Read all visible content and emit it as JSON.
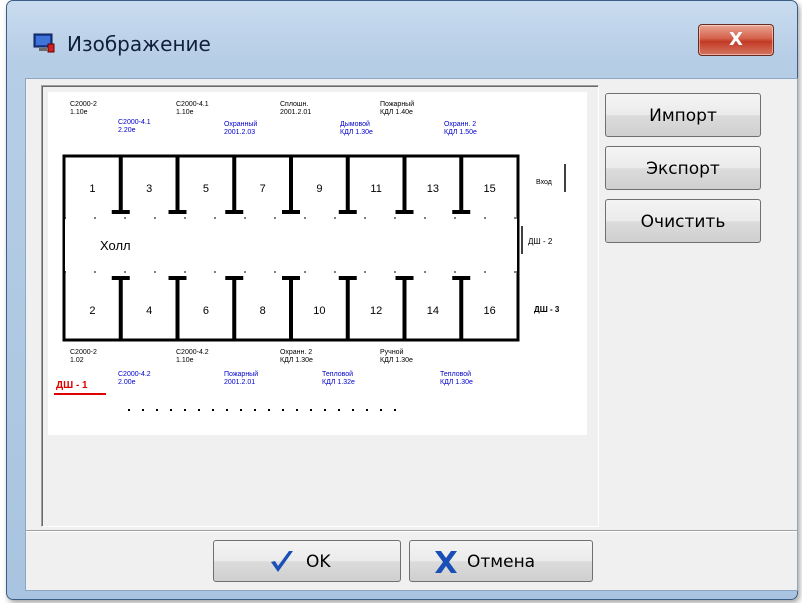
{
  "window": {
    "title": "Изображение",
    "icon": "monitor-icon",
    "close_icon": "close-x-icon",
    "close_glyph": "X"
  },
  "plan": {
    "rooms_top": [
      "1",
      "3",
      "5",
      "7",
      "9",
      "11",
      "13",
      "15"
    ],
    "rooms_bottom": [
      "2",
      "4",
      "6",
      "8",
      "10",
      "12",
      "14",
      "16"
    ],
    "hall_label": "Холл",
    "top_labels": [
      {
        "l1": "С2000-2",
        "l2": "1.10е",
        "color": "#000000"
      },
      {
        "l1": "С2000-4.1",
        "l2": "1.10е",
        "color": "#000000"
      },
      {
        "l1": "Сплошн.",
        "l2": "2001.2.01",
        "color": "#000000"
      },
      {
        "l1": "Пожарный",
        "l2": "КДЛ 1.40е",
        "color": "#000000"
      },
      {
        "l1": "С2000-4.1",
        "l2": "2.20е",
        "color": "#0000cc"
      },
      {
        "l1": "Охранный",
        "l2": "2001.2.03",
        "color": "#0000cc"
      },
      {
        "l1": "Дымовой",
        "l2": "КДЛ 1.30е",
        "color": "#0000cc"
      },
      {
        "l1": "Охранн. 2",
        "l2": "КДЛ 1.50е",
        "color": "#0000cc"
      }
    ],
    "bottom_labels": [
      {
        "l1": "С2000-2",
        "l2": "1.02",
        "color": "#000000"
      },
      {
        "l1": "С2000-4.2",
        "l2": "1.10е",
        "color": "#000000"
      },
      {
        "l1": "Охранн. 2",
        "l2": "КДЛ 1.30е",
        "color": "#000000"
      },
      {
        "l1": "Ручной",
        "l2": "КДЛ 1.30е",
        "color": "#000000"
      },
      {
        "l1": "С2000-4.2",
        "l2": "2.00е",
        "color": "#0000cc"
      },
      {
        "l1": "Пожарный",
        "l2": "2001.2.01",
        "color": "#0000cc"
      },
      {
        "l1": "Тепловой",
        "l2": "КДЛ 1.32е",
        "color": "#0000cc"
      },
      {
        "l1": "Тепловой",
        "l2": "КДЛ 1.30е",
        "color": "#0000cc"
      }
    ],
    "side_labels": [
      "Вход",
      "ДШ - 2",
      "ДШ - 3"
    ],
    "legend_red": "ДШ - 1"
  },
  "buttons": {
    "import": "Импорт",
    "export": "Экспорт",
    "clear": "Очистить",
    "ok": "OK",
    "cancel": "Отмена"
  },
  "colors": {
    "accent_blue": "#1a4fb8",
    "red": "#e00000"
  }
}
